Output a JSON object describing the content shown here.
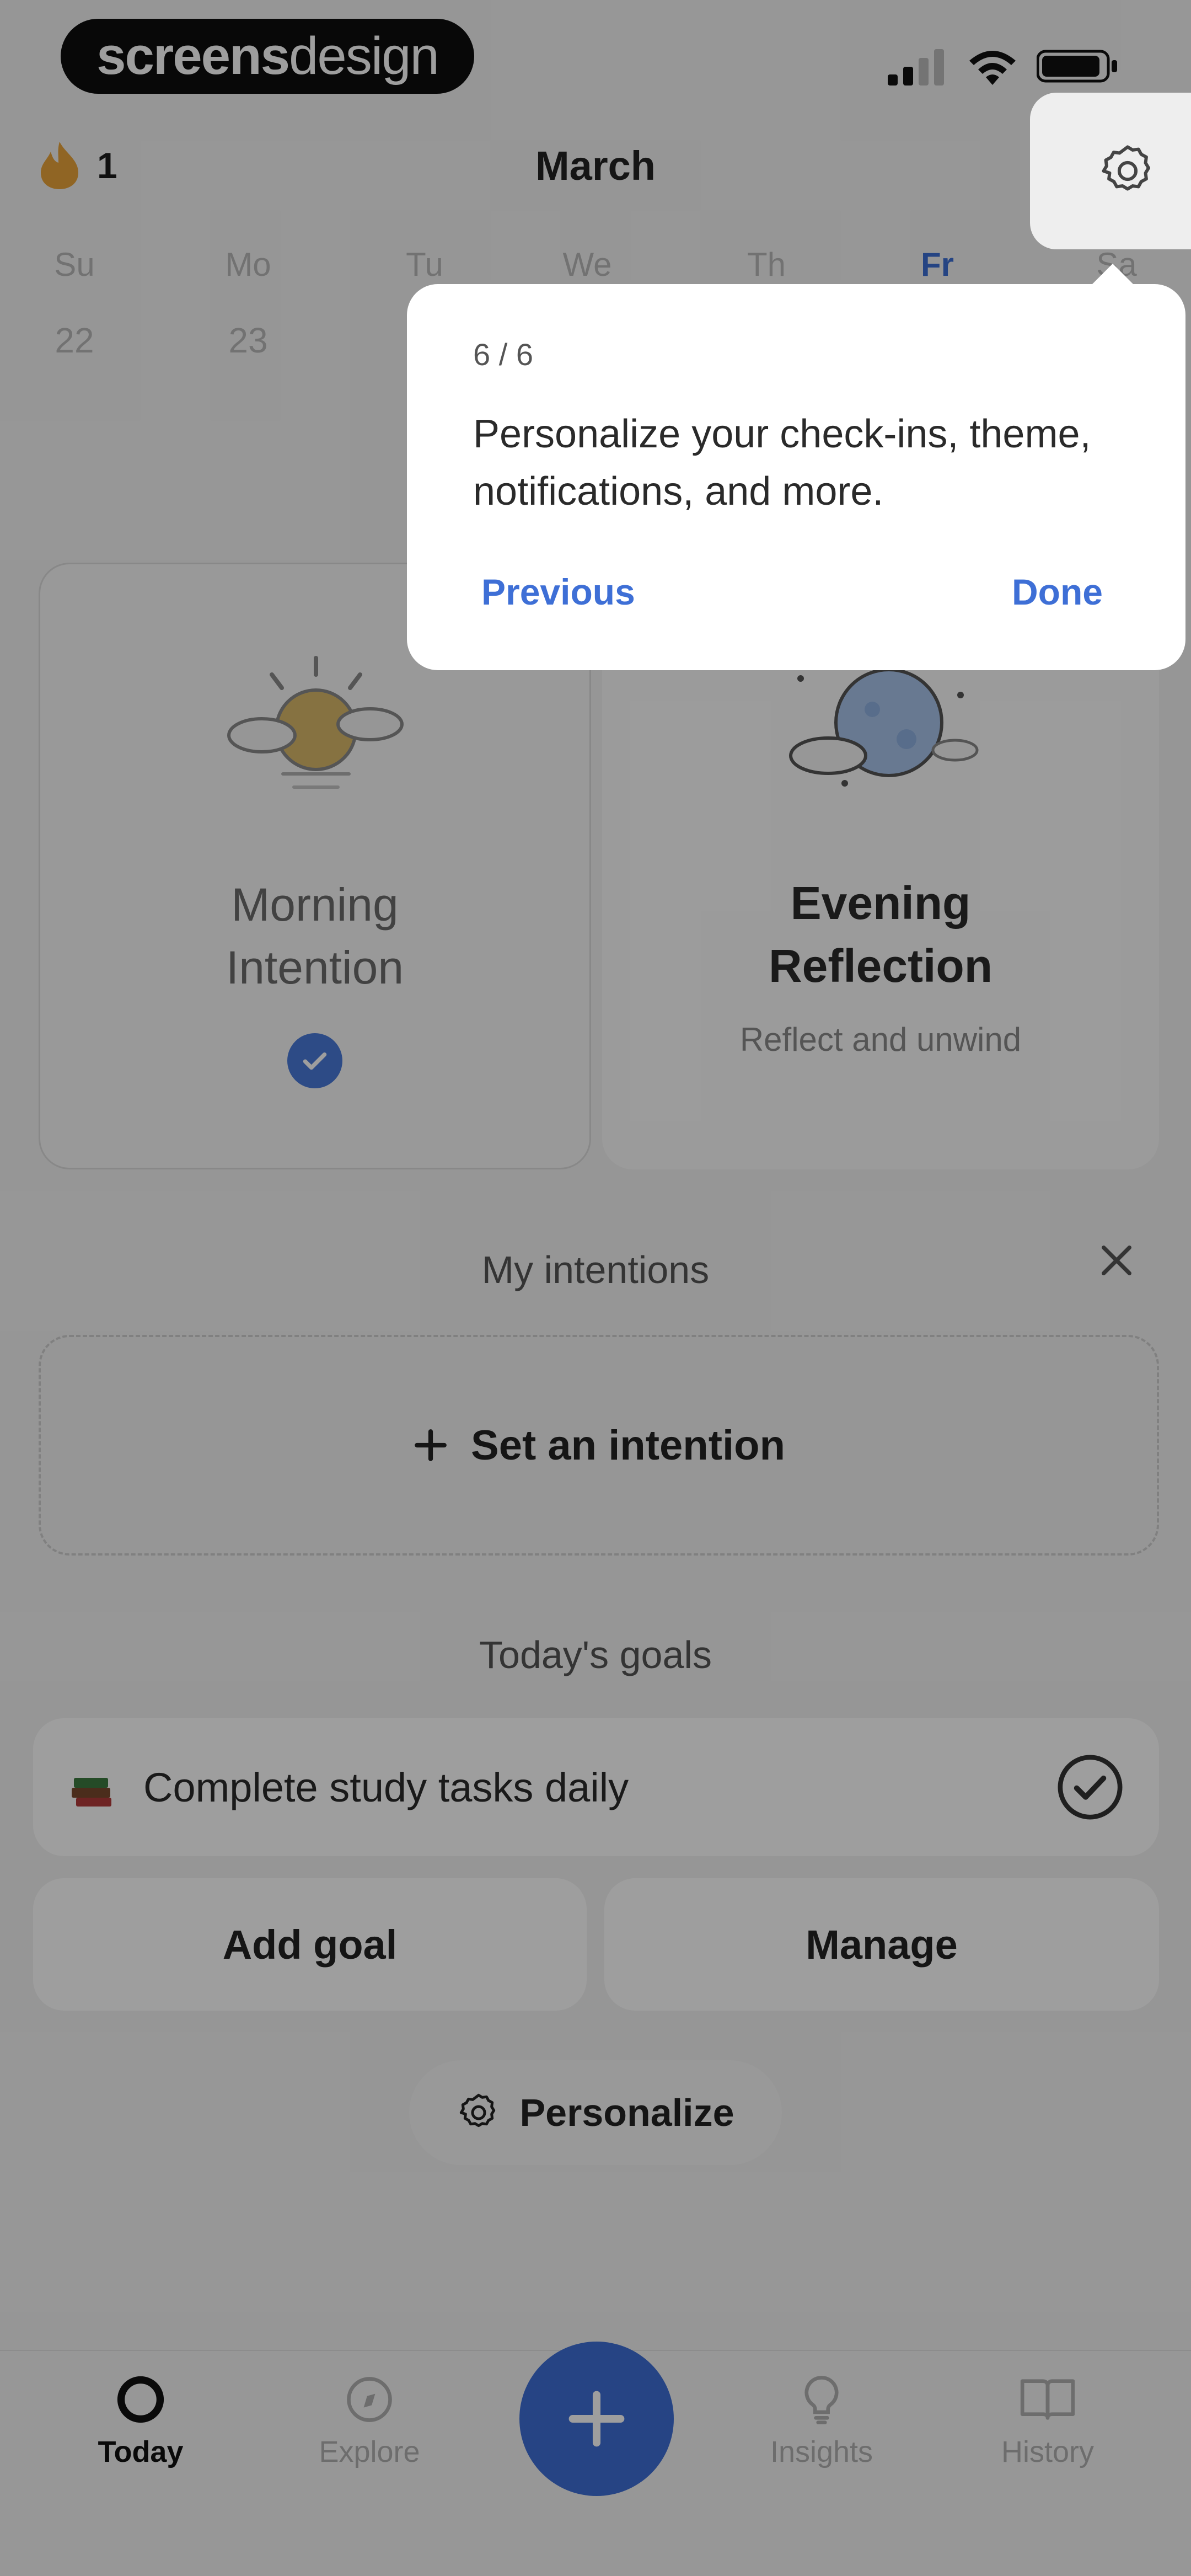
{
  "status_bar": {
    "brand_part1": "screens",
    "brand_part2": "design"
  },
  "header": {
    "streak_count": "1",
    "month": "March"
  },
  "week": {
    "days": [
      "Su",
      "Mo",
      "Tu",
      "We",
      "Th",
      "Fr",
      "Sa"
    ],
    "active_day": "Fr",
    "dates": [
      "22",
      "23"
    ]
  },
  "cards": {
    "morning": {
      "title_line1": "Morning",
      "title_line2": "Intention",
      "completed": true
    },
    "evening": {
      "title_line1": "Evening",
      "title_line2": "Reflection",
      "subtitle": "Reflect and unwind"
    }
  },
  "intentions": {
    "heading": "My intentions",
    "add_label": "Set an intention"
  },
  "goals": {
    "heading": "Today's goals",
    "items": [
      {
        "label": "Complete study tasks daily",
        "done": true
      }
    ],
    "add_label": "Add goal",
    "manage_label": "Manage"
  },
  "personalize_label": "Personalize",
  "tabs": [
    {
      "label": "Today",
      "icon": "circle-icon",
      "active": true
    },
    {
      "label": "Explore",
      "icon": "compass-icon",
      "active": false
    },
    {
      "label": "Insights",
      "icon": "lightbulb-icon",
      "active": false
    },
    {
      "label": "History",
      "icon": "book-icon",
      "active": false
    }
  ],
  "tooltip": {
    "step": "6 / 6",
    "text": "Personalize your check-ins, theme, notifications, and more.",
    "previous_label": "Previous",
    "done_label": "Done"
  },
  "colors": {
    "accent": "#3e6ed6",
    "overlay": "rgba(0,0,0,0.38)"
  }
}
